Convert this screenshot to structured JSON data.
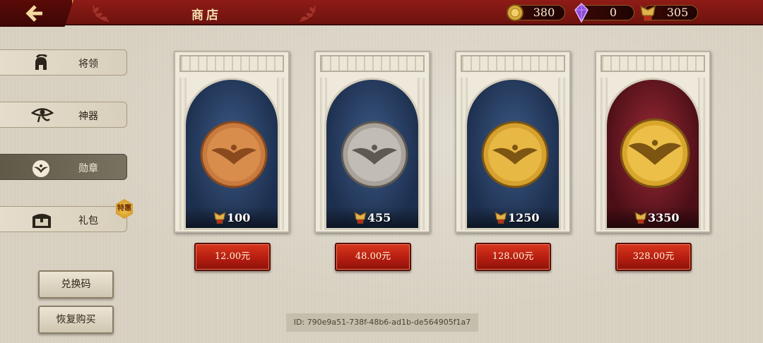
{
  "header": {
    "title": "商店",
    "currencies": [
      {
        "icon": "gold-coin-icon",
        "value": "380"
      },
      {
        "icon": "purple-gem-icon",
        "value": "0"
      },
      {
        "icon": "medal-icon",
        "value": "305"
      }
    ]
  },
  "sidebar": {
    "tabs": [
      {
        "label": "将领",
        "icon": "spartan-helmet-icon",
        "active": false
      },
      {
        "label": "神器",
        "icon": "eye-of-horus-icon",
        "active": false
      },
      {
        "label": "勋章",
        "icon": "eagle-emblem-icon",
        "active": true
      },
      {
        "label": "礼包",
        "icon": "treasure-chest-icon",
        "active": false,
        "badge": "特惠"
      }
    ],
    "redeem_label": "兑换码",
    "restore_label": "恢复购买"
  },
  "shop": {
    "items": [
      {
        "amount": "100",
        "price": "12.00元",
        "coin": "bronze",
        "backdrop": "blue"
      },
      {
        "amount": "455",
        "price": "48.00元",
        "coin": "silver",
        "backdrop": "blue"
      },
      {
        "amount": "1250",
        "price": "128.00元",
        "coin": "gold",
        "backdrop": "blue"
      },
      {
        "amount": "3350",
        "price": "328.00元",
        "coin": "gold",
        "backdrop": "red"
      }
    ]
  },
  "footer": {
    "id_text": "ID: 790e9a51-738f-48b6-ad1b-de564905f1a7"
  },
  "colors": {
    "top_bar": "#8e1b16",
    "price_button": "#c4281a",
    "gold_accent": "#c9a14b"
  }
}
